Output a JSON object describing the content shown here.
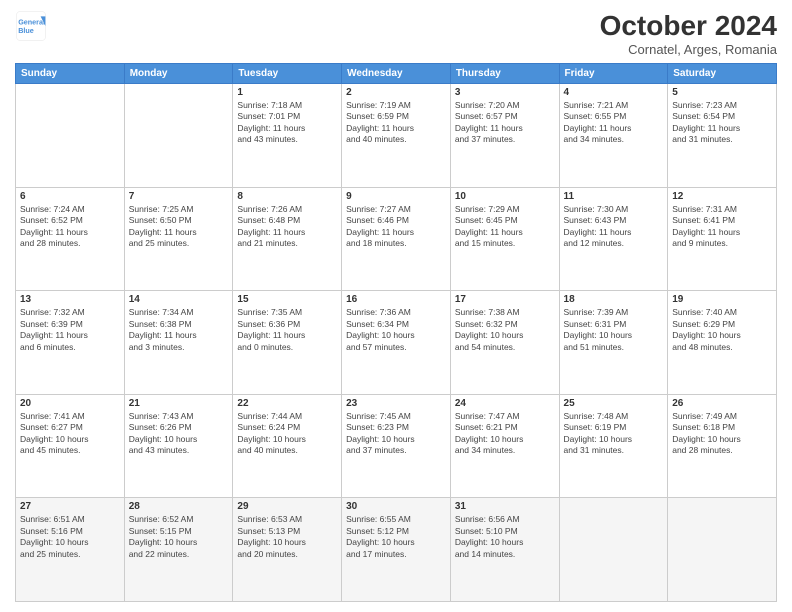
{
  "header": {
    "logo_line1": "General",
    "logo_line2": "Blue",
    "month": "October 2024",
    "location": "Cornatel, Arges, Romania"
  },
  "weekdays": [
    "Sunday",
    "Monday",
    "Tuesday",
    "Wednesday",
    "Thursday",
    "Friday",
    "Saturday"
  ],
  "weeks": [
    [
      {
        "day": "",
        "info": ""
      },
      {
        "day": "",
        "info": ""
      },
      {
        "day": "1",
        "info": "Sunrise: 7:18 AM\nSunset: 7:01 PM\nDaylight: 11 hours\nand 43 minutes."
      },
      {
        "day": "2",
        "info": "Sunrise: 7:19 AM\nSunset: 6:59 PM\nDaylight: 11 hours\nand 40 minutes."
      },
      {
        "day": "3",
        "info": "Sunrise: 7:20 AM\nSunset: 6:57 PM\nDaylight: 11 hours\nand 37 minutes."
      },
      {
        "day": "4",
        "info": "Sunrise: 7:21 AM\nSunset: 6:55 PM\nDaylight: 11 hours\nand 34 minutes."
      },
      {
        "day": "5",
        "info": "Sunrise: 7:23 AM\nSunset: 6:54 PM\nDaylight: 11 hours\nand 31 minutes."
      }
    ],
    [
      {
        "day": "6",
        "info": "Sunrise: 7:24 AM\nSunset: 6:52 PM\nDaylight: 11 hours\nand 28 minutes."
      },
      {
        "day": "7",
        "info": "Sunrise: 7:25 AM\nSunset: 6:50 PM\nDaylight: 11 hours\nand 25 minutes."
      },
      {
        "day": "8",
        "info": "Sunrise: 7:26 AM\nSunset: 6:48 PM\nDaylight: 11 hours\nand 21 minutes."
      },
      {
        "day": "9",
        "info": "Sunrise: 7:27 AM\nSunset: 6:46 PM\nDaylight: 11 hours\nand 18 minutes."
      },
      {
        "day": "10",
        "info": "Sunrise: 7:29 AM\nSunset: 6:45 PM\nDaylight: 11 hours\nand 15 minutes."
      },
      {
        "day": "11",
        "info": "Sunrise: 7:30 AM\nSunset: 6:43 PM\nDaylight: 11 hours\nand 12 minutes."
      },
      {
        "day": "12",
        "info": "Sunrise: 7:31 AM\nSunset: 6:41 PM\nDaylight: 11 hours\nand 9 minutes."
      }
    ],
    [
      {
        "day": "13",
        "info": "Sunrise: 7:32 AM\nSunset: 6:39 PM\nDaylight: 11 hours\nand 6 minutes."
      },
      {
        "day": "14",
        "info": "Sunrise: 7:34 AM\nSunset: 6:38 PM\nDaylight: 11 hours\nand 3 minutes."
      },
      {
        "day": "15",
        "info": "Sunrise: 7:35 AM\nSunset: 6:36 PM\nDaylight: 11 hours\nand 0 minutes."
      },
      {
        "day": "16",
        "info": "Sunrise: 7:36 AM\nSunset: 6:34 PM\nDaylight: 10 hours\nand 57 minutes."
      },
      {
        "day": "17",
        "info": "Sunrise: 7:38 AM\nSunset: 6:32 PM\nDaylight: 10 hours\nand 54 minutes."
      },
      {
        "day": "18",
        "info": "Sunrise: 7:39 AM\nSunset: 6:31 PM\nDaylight: 10 hours\nand 51 minutes."
      },
      {
        "day": "19",
        "info": "Sunrise: 7:40 AM\nSunset: 6:29 PM\nDaylight: 10 hours\nand 48 minutes."
      }
    ],
    [
      {
        "day": "20",
        "info": "Sunrise: 7:41 AM\nSunset: 6:27 PM\nDaylight: 10 hours\nand 45 minutes."
      },
      {
        "day": "21",
        "info": "Sunrise: 7:43 AM\nSunset: 6:26 PM\nDaylight: 10 hours\nand 43 minutes."
      },
      {
        "day": "22",
        "info": "Sunrise: 7:44 AM\nSunset: 6:24 PM\nDaylight: 10 hours\nand 40 minutes."
      },
      {
        "day": "23",
        "info": "Sunrise: 7:45 AM\nSunset: 6:23 PM\nDaylight: 10 hours\nand 37 minutes."
      },
      {
        "day": "24",
        "info": "Sunrise: 7:47 AM\nSunset: 6:21 PM\nDaylight: 10 hours\nand 34 minutes."
      },
      {
        "day": "25",
        "info": "Sunrise: 7:48 AM\nSunset: 6:19 PM\nDaylight: 10 hours\nand 31 minutes."
      },
      {
        "day": "26",
        "info": "Sunrise: 7:49 AM\nSunset: 6:18 PM\nDaylight: 10 hours\nand 28 minutes."
      }
    ],
    [
      {
        "day": "27",
        "info": "Sunrise: 6:51 AM\nSunset: 5:16 PM\nDaylight: 10 hours\nand 25 minutes."
      },
      {
        "day": "28",
        "info": "Sunrise: 6:52 AM\nSunset: 5:15 PM\nDaylight: 10 hours\nand 22 minutes."
      },
      {
        "day": "29",
        "info": "Sunrise: 6:53 AM\nSunset: 5:13 PM\nDaylight: 10 hours\nand 20 minutes."
      },
      {
        "day": "30",
        "info": "Sunrise: 6:55 AM\nSunset: 5:12 PM\nDaylight: 10 hours\nand 17 minutes."
      },
      {
        "day": "31",
        "info": "Sunrise: 6:56 AM\nSunset: 5:10 PM\nDaylight: 10 hours\nand 14 minutes."
      },
      {
        "day": "",
        "info": ""
      },
      {
        "day": "",
        "info": ""
      }
    ]
  ]
}
